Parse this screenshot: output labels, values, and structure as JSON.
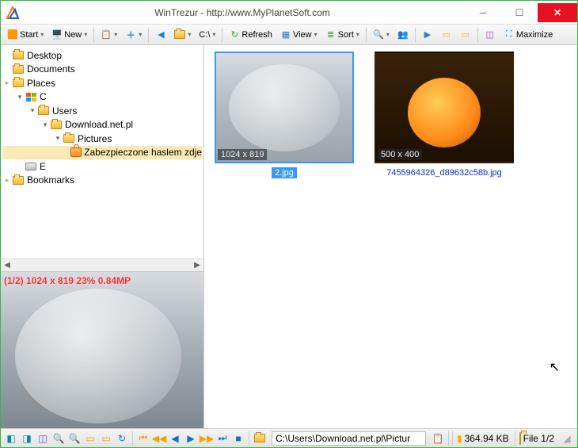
{
  "title": "WinTrezur - http://www.MyPlanetSoft.com",
  "toolbar": {
    "start": "Start",
    "new": "New",
    "drive": "C:\\",
    "refresh": "Refresh",
    "view": "View",
    "sort": "Sort",
    "maximize": "Maximize"
  },
  "tree": [
    {
      "depth": 0,
      "twisty": "",
      "icon": "folder",
      "label": "Desktop"
    },
    {
      "depth": 0,
      "twisty": "",
      "icon": "folder",
      "label": "Documents"
    },
    {
      "depth": 0,
      "twisty": "closed",
      "icon": "folder",
      "label": "Places"
    },
    {
      "depth": 1,
      "twisty": "open",
      "icon": "windows",
      "label": "C"
    },
    {
      "depth": 2,
      "twisty": "open",
      "icon": "folder",
      "label": "Users"
    },
    {
      "depth": 3,
      "twisty": "open",
      "icon": "folder",
      "label": "Download.net.pl"
    },
    {
      "depth": 4,
      "twisty": "open",
      "icon": "folder",
      "label": "Pictures"
    },
    {
      "depth": 5,
      "twisty": "",
      "icon": "lock",
      "label": "Zabezpieczone haslem zdje",
      "selected": true
    },
    {
      "depth": 1,
      "twisty": "",
      "icon": "drive",
      "label": "E"
    },
    {
      "depth": 0,
      "twisty": "closed",
      "icon": "folder",
      "label": "Bookmarks"
    }
  ],
  "preview_overlay": "(1/2) 1024 x 819 23% 0.84MP",
  "thumbs": [
    {
      "dims": "1024 x 819",
      "name": "2.jpg",
      "selected": true,
      "kind": "umbrella"
    },
    {
      "dims": "500 x 400",
      "name": "7455964326_d89632c58b.jpg",
      "selected": false,
      "kind": "orange"
    }
  ],
  "status": {
    "path": "C:\\Users\\Download.net.pl\\Pictur",
    "size": "364.94 KB",
    "count": "File 1/2"
  }
}
